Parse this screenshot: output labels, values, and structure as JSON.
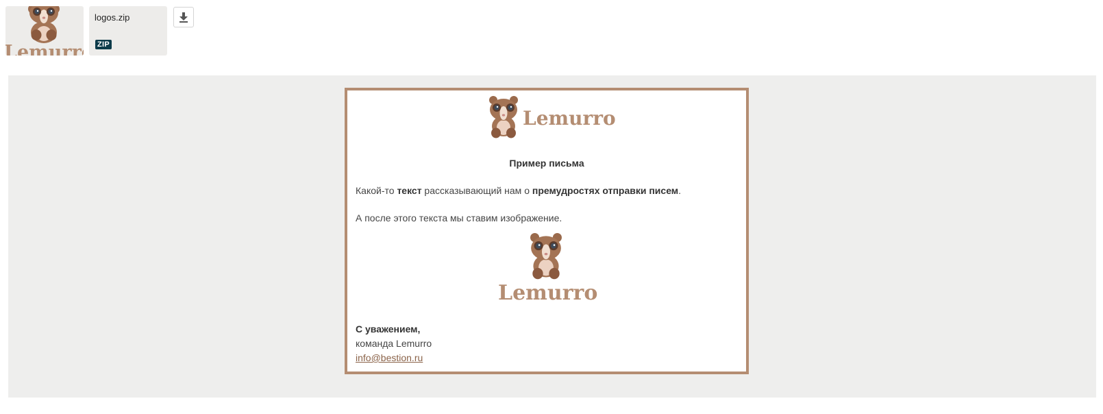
{
  "attachments": {
    "thumbnail_word": "Lemurro",
    "file": {
      "name": "logos.zip",
      "type_badge": "ZIP"
    },
    "download_icon": "download-icon"
  },
  "mail": {
    "brand": "Lemurro",
    "subject": "Пример письма",
    "paragraph1": {
      "t1": "Какой-то ",
      "b1": "текст",
      "t2": " рассказывающий нам о ",
      "b2": "премудростях отправки писем",
      "t3": "."
    },
    "paragraph2": "А после этого текста мы ставим изображение.",
    "image_word": "Lemurro",
    "signature": {
      "greeting": "С уважением,",
      "team": "команда Lemurro",
      "email": "info@bestion.ru"
    }
  },
  "colors": {
    "brand": "#b48d72",
    "badge": "#0d3b4a",
    "preview_bg": "#eeeeed"
  }
}
